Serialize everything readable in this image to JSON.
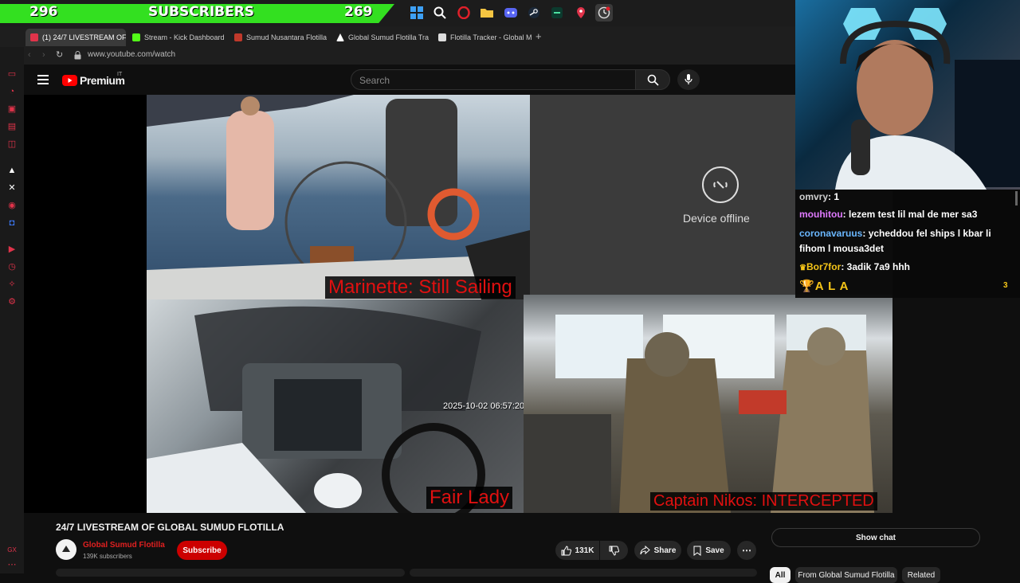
{
  "overlay": {
    "subs_left": "296",
    "subs_label": "SUBSCRIBERS",
    "subs_right": "269",
    "taskbar_icons": [
      "windows-icon",
      "search-icon",
      "opera-icon",
      "folder-icon",
      "discord-icon",
      "steam-icon",
      "app-icon",
      "maps-icon",
      "clock-icon"
    ]
  },
  "browser": {
    "tabs": [
      {
        "label": "(1) 24/7 LIVESTREAM OF",
        "color": "#e0334a"
      },
      {
        "label": "Stream - Kick Dashboard",
        "color": "#53fc18"
      },
      {
        "label": "Sumud Nusantara Flotilla",
        "color": "#c0392b"
      },
      {
        "label": "Global Sumud Flotilla Tra",
        "color": "#ffffff"
      },
      {
        "label": "Flotilla Tracker - Global M",
        "color": "#dddddd"
      }
    ],
    "url": "www.youtube.com/watch"
  },
  "youtube": {
    "logo": "Premium",
    "region": "IT",
    "search_placeholder": "Search"
  },
  "video": {
    "captions": {
      "marinette": "Marinette: Still Sailing",
      "fair_lady": "Fair Lady",
      "nikos": "Captain Nikos: INTERCEPTED"
    },
    "timestamp": "2025-10-02 06:57:20",
    "offline_text": "Device offline"
  },
  "chat": {
    "messages": [
      {
        "user": "omvry",
        "text": ": 1",
        "color": "#cfcfcf"
      },
      {
        "user": "mouhitou",
        "text": ": lezem test lil mal de mer sa3",
        "color": "#e07aff"
      },
      {
        "user": "coronavaruus",
        "text": ": ycheddou fel ships l kbar li",
        "color": "#6ab7ff"
      },
      {
        "user": "",
        "text": "fihom l mousa3det",
        "color": "#ffffff"
      },
      {
        "user": "Bor7for",
        "text": ": 3adik 7a9 hhh",
        "color": "#f5c518"
      }
    ],
    "leader_name": "A L A",
    "leader_count": "3"
  },
  "watch": {
    "title": "24/7 LIVESTREAM OF GLOBAL SUMUD FLOTILLA",
    "channel": "Global Sumud Flotilla",
    "subscribers": "139K subscribers",
    "subscribe_label": "Subscribe",
    "likes": "131K",
    "share_label": "Share",
    "save_label": "Save",
    "show_chat_label": "Show chat",
    "chips": [
      "All",
      "From Global Sumud Flotilla",
      "Related"
    ]
  }
}
